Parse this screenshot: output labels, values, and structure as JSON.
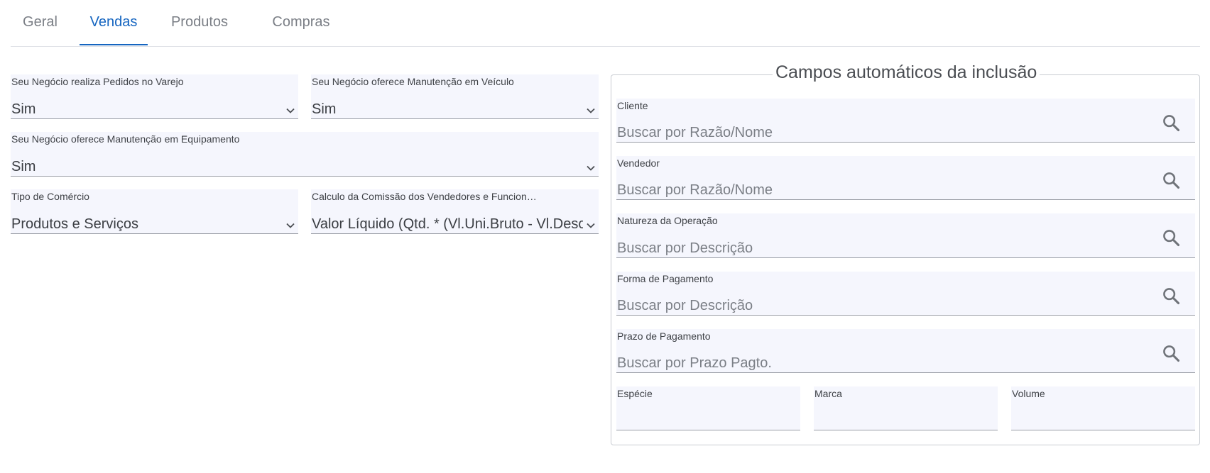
{
  "tabs": [
    {
      "label": "Geral",
      "active": false
    },
    {
      "label": "Vendas",
      "active": true
    },
    {
      "label": "Produtos",
      "active": false
    },
    {
      "label": "Compras",
      "active": false
    }
  ],
  "left_form": {
    "varejo": {
      "label": "Seu Negócio realiza Pedidos no Varejo",
      "value": "Sim"
    },
    "manut_veiculo": {
      "label": "Seu Negócio oferece Manutenção em Veículo",
      "value": "Sim"
    },
    "manut_equip": {
      "label": "Seu Negócio oferece Manutenção em Equipamento",
      "value": "Sim"
    },
    "tipo_comercio": {
      "label": "Tipo de Comércio",
      "value": "Produtos e Serviços"
    },
    "comissao": {
      "label": "Calculo da Comissão dos Vendedores e Funcion…",
      "value": "Valor Líquido (Qtd. * (Vl.Uni.Bruto - Vl.Desc."
    }
  },
  "auto_fields": {
    "legend": "Campos automáticos da inclusão",
    "cliente": {
      "label": "Cliente",
      "placeholder": "Buscar por Razão/Nome"
    },
    "vendedor": {
      "label": "Vendedor",
      "placeholder": "Buscar por Razão/Nome"
    },
    "natureza": {
      "label": "Natureza da Operação",
      "placeholder": "Buscar por Descrição"
    },
    "forma_pagto": {
      "label": "Forma de Pagamento",
      "placeholder": "Buscar por Descrição"
    },
    "prazo_pagto": {
      "label": "Prazo de Pagamento",
      "placeholder": "Buscar por Prazo Pagto."
    },
    "especie": {
      "label": "Espécie",
      "value": ""
    },
    "marca": {
      "label": "Marca",
      "value": ""
    },
    "volume": {
      "label": "Volume",
      "value": ""
    }
  },
  "icons": {
    "dropdown": "chevron-down-icon",
    "search": "search-icon"
  },
  "colors": {
    "accent": "#1565c0",
    "field_bg": "#f5f6fd",
    "tab_inactive": "#7b7f86"
  }
}
